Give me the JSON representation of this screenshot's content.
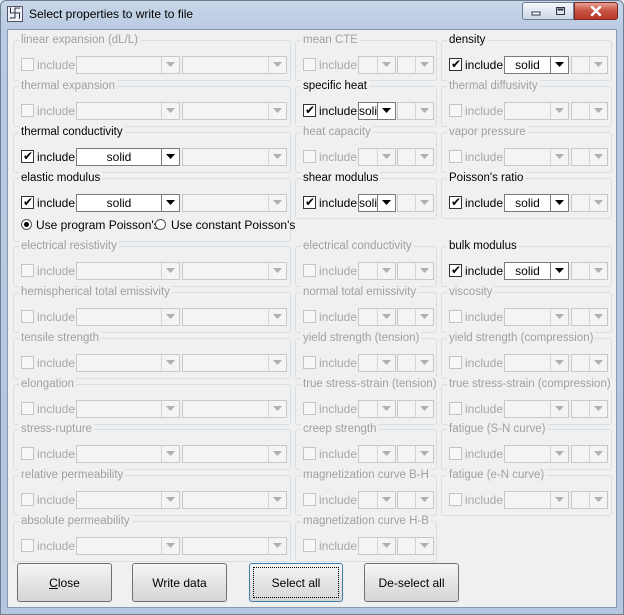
{
  "window": {
    "title": "Select properties to write to file",
    "icon": "app-icon",
    "icon_glyph": "卐",
    "controls": [
      "minimize-icon",
      "maximize-icon",
      "close-icon"
    ]
  },
  "include_label": "include",
  "properties": [
    {
      "key": "linear-expansion",
      "label": "linear expansion (dL/L)",
      "enabled": false,
      "checked": false,
      "value": ""
    },
    {
      "key": "mean-cte",
      "label": "mean CTE",
      "enabled": false,
      "checked": false,
      "value": ""
    },
    {
      "key": "density",
      "label": "density",
      "enabled": true,
      "checked": true,
      "value": "solid"
    },
    {
      "key": "thermal-expansion",
      "label": "thermal expansion",
      "enabled": false,
      "checked": false,
      "value": ""
    },
    {
      "key": "specific-heat",
      "label": "specific heat",
      "enabled": true,
      "checked": true,
      "value": "solid"
    },
    {
      "key": "thermal-diffusivity",
      "label": "thermal diffusivity",
      "enabled": false,
      "checked": false,
      "value": ""
    },
    {
      "key": "thermal-conductivity",
      "label": "thermal conductivity",
      "enabled": true,
      "checked": true,
      "value": "solid"
    },
    {
      "key": "heat-capacity",
      "label": "heat capacity",
      "enabled": false,
      "checked": false,
      "value": ""
    },
    {
      "key": "vapor-pressure",
      "label": "vapor pressure",
      "enabled": false,
      "checked": false,
      "value": ""
    },
    {
      "key": "elastic-modulus",
      "label": "elastic modulus",
      "enabled": true,
      "checked": true,
      "value": "solid"
    },
    {
      "key": "shear-modulus",
      "label": "shear modulus",
      "enabled": true,
      "checked": true,
      "value": "solid"
    },
    {
      "key": "poissons-ratio",
      "label": "Poisson's ratio",
      "enabled": true,
      "checked": true,
      "value": "solid"
    },
    {
      "key": "electrical-resistivity",
      "label": "electrical resistivity",
      "enabled": false,
      "checked": false,
      "value": ""
    },
    {
      "key": "electrical-conductivity",
      "label": "electrical conductivity",
      "enabled": false,
      "checked": false,
      "value": ""
    },
    {
      "key": "bulk-modulus",
      "label": "bulk modulus",
      "enabled": true,
      "checked": true,
      "value": "solid"
    },
    {
      "key": "hemispherical-total-emissivity",
      "label": "hemispherical total emissivity",
      "enabled": false,
      "checked": false,
      "value": ""
    },
    {
      "key": "normal-total-emissivity",
      "label": "normal total emissivity",
      "enabled": false,
      "checked": false,
      "value": ""
    },
    {
      "key": "viscosity",
      "label": "viscosity",
      "enabled": false,
      "checked": false,
      "value": ""
    },
    {
      "key": "tensile-strength",
      "label": "tensile strength",
      "enabled": false,
      "checked": false,
      "value": ""
    },
    {
      "key": "yield-strength-tension",
      "label": "yield strength (tension)",
      "enabled": false,
      "checked": false,
      "value": ""
    },
    {
      "key": "yield-strength-compression",
      "label": "yield strength (compression)",
      "enabled": false,
      "checked": false,
      "value": ""
    },
    {
      "key": "elongation",
      "label": "elongation",
      "enabled": false,
      "checked": false,
      "value": ""
    },
    {
      "key": "true-stress-strain-tension",
      "label": "true stress-strain (tension)",
      "enabled": false,
      "checked": false,
      "value": ""
    },
    {
      "key": "true-stress-strain-compression",
      "label": "true stress-strain (compression)",
      "enabled": false,
      "checked": false,
      "value": ""
    },
    {
      "key": "stress-rupture",
      "label": "stress-rupture",
      "enabled": false,
      "checked": false,
      "value": ""
    },
    {
      "key": "creep-strength",
      "label": "creep strength",
      "enabled": false,
      "checked": false,
      "value": ""
    },
    {
      "key": "fatigue-s-n",
      "label": "fatigue (S-N curve)",
      "enabled": false,
      "checked": false,
      "value": ""
    },
    {
      "key": "relative-permeability",
      "label": "relative permeability",
      "enabled": false,
      "checked": false,
      "value": ""
    },
    {
      "key": "magnetization-curve-b-h",
      "label": "magnetization curve B-H",
      "enabled": false,
      "checked": false,
      "value": ""
    },
    {
      "key": "fatigue-e-n",
      "label": "fatigue (e-N curve)",
      "enabled": false,
      "checked": false,
      "value": ""
    },
    {
      "key": "absolute-permeability",
      "label": "absolute permeability",
      "enabled": false,
      "checked": false,
      "value": ""
    },
    {
      "key": "magnetization-curve-h-b",
      "label": "magnetization curve H-B",
      "enabled": false,
      "checked": false,
      "value": ""
    }
  ],
  "poisson_options": {
    "program": "Use program Poisson's",
    "constant": "Use constant Poisson's",
    "selected": "program"
  },
  "buttons": {
    "close": "Close",
    "close_mnemonic": "C",
    "close_rest": "lose",
    "write": "Write data",
    "select_all": "Select all",
    "deselect_all": "De-select all"
  },
  "colors": {
    "titlebar": "#b9cbe2",
    "client_bg": "#f0f0f0",
    "disabled_text": "#a0a0a0",
    "close_button": "#c75040"
  }
}
